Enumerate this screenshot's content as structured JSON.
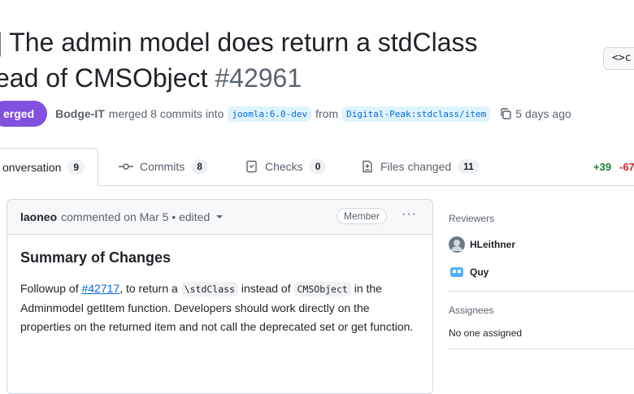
{
  "pr": {
    "title_line1": "] The admin model does return a stdClass",
    "title_line2": "ead of CMSObject ",
    "number": "#42961",
    "status": "erged",
    "author": "Bodge-IT",
    "action": "merged 8 commits into",
    "base_branch": "joomla:6.0-dev",
    "from_text": "from",
    "head_branch": "Digital-Peak:stdclass/item",
    "time": "5 days ago",
    "code_button": "<>c"
  },
  "tabs": [
    {
      "label": "onversation",
      "count": "9"
    },
    {
      "label": "Commits",
      "count": "8"
    },
    {
      "label": "Checks",
      "count": "0"
    },
    {
      "label": "Files changed",
      "count": "11"
    }
  ],
  "diffstat": {
    "added": "+39",
    "removed": "-67"
  },
  "comment": {
    "author": "laoneo",
    "meta": "commented on Mar 5 • edited",
    "role": "Member",
    "menu": "···",
    "heading": "Summary of Changes",
    "body": {
      "t1": "Followup of ",
      "link": "#42717",
      "t2": ", to return a ",
      "code1": "\\stdClass",
      "t3": " instead of ",
      "code2": "CMSObject",
      "t4": " in the Adminmodel getItem function. Developers should work directly on the properties on the returned item and not call the deprecated set or get function."
    }
  },
  "sidebar": {
    "reviewers_title": "Reviewers",
    "reviewers": [
      {
        "name": "HLeithner",
        "avatar_color": "#6e7781"
      },
      {
        "name": "Quy",
        "avatar_color": "#54aeff"
      }
    ],
    "assignees_title": "Assignees",
    "assignees_value": "No one assigned"
  },
  "colors": {
    "merged": "#8250df",
    "link": "#0969da",
    "added": "#1a7f37",
    "removed": "#d1242f"
  }
}
